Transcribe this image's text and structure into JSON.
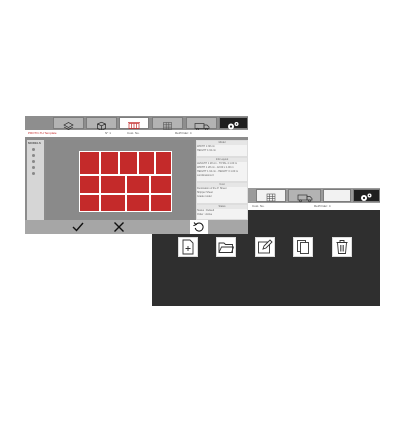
{
  "front_window": {
    "toolbar_icons": [
      "layers-icon",
      "cube-icon",
      "cart-icon",
      "grid-icon",
      "truck-icon",
      "gears-icon"
    ],
    "info": {
      "project_label": "PROTO-TH Template",
      "field_a": "N° 1",
      "field_b": "Cust. No.",
      "field_c": "Ref/Order: 4"
    },
    "left_panel": {
      "heading": "MODELS",
      "options": [
        "1",
        "2",
        "3",
        "4",
        "5"
      ]
    },
    "right_panel": {
      "sections": [
        {
          "heading": "Model",
          "lines": [
            "WIDTH 1:38 cm",
            "HEIGHT 1:32 cm"
          ]
        },
        {
          "heading": "Info Layout",
          "lines": [
            "LENGTH 1 28 cm - TOTAL 4 1.00 m",
            "WIDTH 1 28 cm - 42:00 x 1.00 m",
            "HEIGHT 1 34 cm - HEIGHT 3 1.00 m",
            "combinations 0"
          ]
        },
        {
          "heading": "Cust",
          "lines": [
            "Destination of the P. Sheet",
            "Shipper Sheet",
            "Grade model"
          ]
        },
        {
          "heading": "Status",
          "lines": [
            "Status : Default",
            "Order : Active"
          ]
        }
      ]
    },
    "action_icons": [
      "confirm-check-icon",
      "cancel-x-icon",
      "undo-icon"
    ]
  },
  "back_window": {
    "toolbar_icons": [
      "grid-icon",
      "truck-icon",
      "gears-icon"
    ],
    "info": {
      "field_b": "Cust. No.",
      "field_c": "Ref/Order: 4"
    },
    "file_actions": [
      "new-file-icon",
      "open-folder-icon",
      "edit-icon",
      "copy-icon",
      "delete-trash-icon"
    ]
  }
}
